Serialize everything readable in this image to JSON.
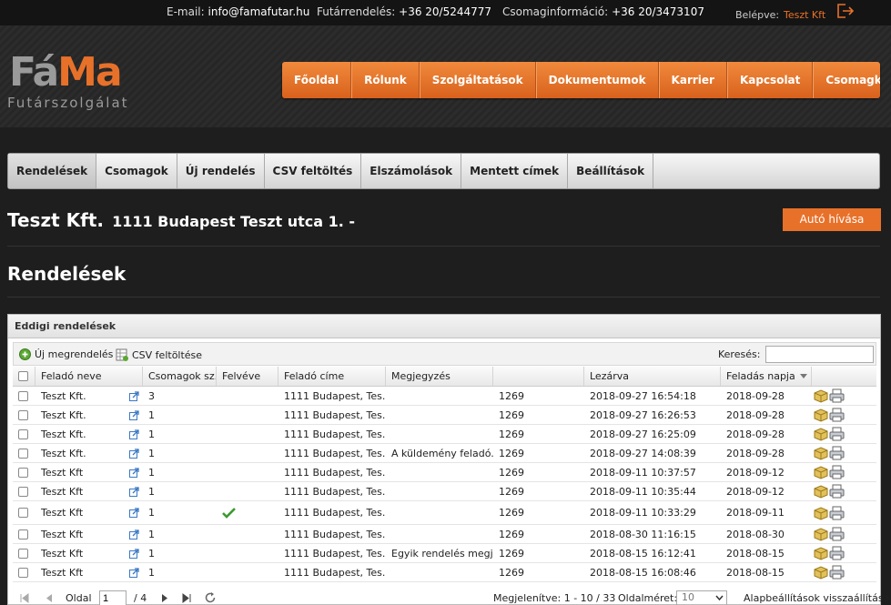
{
  "topbar": {
    "email_label": "E-mail:",
    "email": "info@famafutar.hu",
    "order_label": "Futárrendelés:",
    "order_phone": "+36 20/5244777",
    "parcel_label": "Csomaginformáció:",
    "parcel_phone": "+36 20/3473107",
    "login_label": "Belépve:",
    "user": "Teszt Kft"
  },
  "logo": {
    "part1": "Fá",
    "part2": "Ma",
    "subtitle": "Futárszolgálat"
  },
  "main_nav": [
    "Főoldal",
    "Rólunk",
    "Szolgáltatások",
    "Dokumentumok",
    "Karrier",
    "Kapcsolat",
    "Csomagkövetés"
  ],
  "sub_nav": [
    "Rendelések",
    "Csomagok",
    "Új rendelés",
    "CSV feltöltés",
    "Elszámolások",
    "Mentett címek",
    "Beállítások"
  ],
  "company": {
    "name": "Teszt Kft.",
    "address": "1111 Budapest Teszt utca 1. -"
  },
  "auto_button": "Autó hívása",
  "page_title": "Rendelések",
  "panel_title": "Eddigi rendelések",
  "toolbar": {
    "new_order": "Új megrendelés",
    "csv_upload": "CSV feltöltése",
    "search_label": "Keresés:"
  },
  "columns": [
    "Feladó neve",
    "Csomagok sz.",
    "Felvéve",
    "Feladó címe",
    "Megjegyzés",
    "",
    "Lezárva",
    "Feladás napja"
  ],
  "rows": [
    {
      "name": "Teszt Kft.",
      "count": "3",
      "picked": false,
      "address": "1111 Budapest, Tes...",
      "note": "",
      "code": "1269",
      "closed": "2018-09-27 16:54:18",
      "date": "2018-09-28"
    },
    {
      "name": "Teszt Kft.",
      "count": "1",
      "picked": false,
      "address": "1111 Budapest, Tes...",
      "note": "",
      "code": "1269",
      "closed": "2018-09-27 16:26:53",
      "date": "2018-09-28"
    },
    {
      "name": "Teszt Kft.",
      "count": "1",
      "picked": false,
      "address": "1111 Budapest, Tes...",
      "note": "",
      "code": "1269",
      "closed": "2018-09-27 16:25:09",
      "date": "2018-09-28"
    },
    {
      "name": "Teszt Kft.",
      "count": "1",
      "picked": false,
      "address": "1111 Budapest, Tes...",
      "note": "A küldemény feladó...",
      "code": "1269",
      "closed": "2018-09-27 14:08:39",
      "date": "2018-09-28"
    },
    {
      "name": "Teszt Kft",
      "count": "1",
      "picked": false,
      "address": "1111 Budapest, Tes...",
      "note": "",
      "code": "1269",
      "closed": "2018-09-11 10:37:57",
      "date": "2018-09-12"
    },
    {
      "name": "Teszt Kft",
      "count": "1",
      "picked": false,
      "address": "1111 Budapest, Tes...",
      "note": "",
      "code": "1269",
      "closed": "2018-09-11 10:35:44",
      "date": "2018-09-12"
    },
    {
      "name": "Teszt Kft",
      "count": "1",
      "picked": true,
      "address": "1111 Budapest, Tes...",
      "note": "",
      "code": "1269",
      "closed": "2018-09-11 10:33:29",
      "date": "2018-09-11"
    },
    {
      "name": "Teszt Kft",
      "count": "1",
      "picked": false,
      "address": "1111 Budapest, Tes...",
      "note": "",
      "code": "1269",
      "closed": "2018-08-30 11:16:15",
      "date": "2018-08-30"
    },
    {
      "name": "Teszt Kft",
      "count": "1",
      "picked": false,
      "address": "1111 Budapest, Tes...",
      "note": "Egyik rendelés megj...",
      "code": "1269",
      "closed": "2018-08-15 16:12:41",
      "date": "2018-08-15"
    },
    {
      "name": "Teszt Kft",
      "count": "1",
      "picked": false,
      "address": "1111 Budapest, Tes...",
      "note": "",
      "code": "1269",
      "closed": "2018-08-15 16:08:46",
      "date": "2018-08-15"
    }
  ],
  "pager": {
    "page_label": "Oldal",
    "page": "1",
    "of_total": "/ 4",
    "displayed": "Megjelenítve: 1 - 10 / 33",
    "page_size_label": "Oldalméret:",
    "page_size": "10",
    "reset": "Alapbeállítások visszaállítása"
  },
  "colors": {
    "accent": "#e8712a",
    "background": "#1e1e1e"
  }
}
